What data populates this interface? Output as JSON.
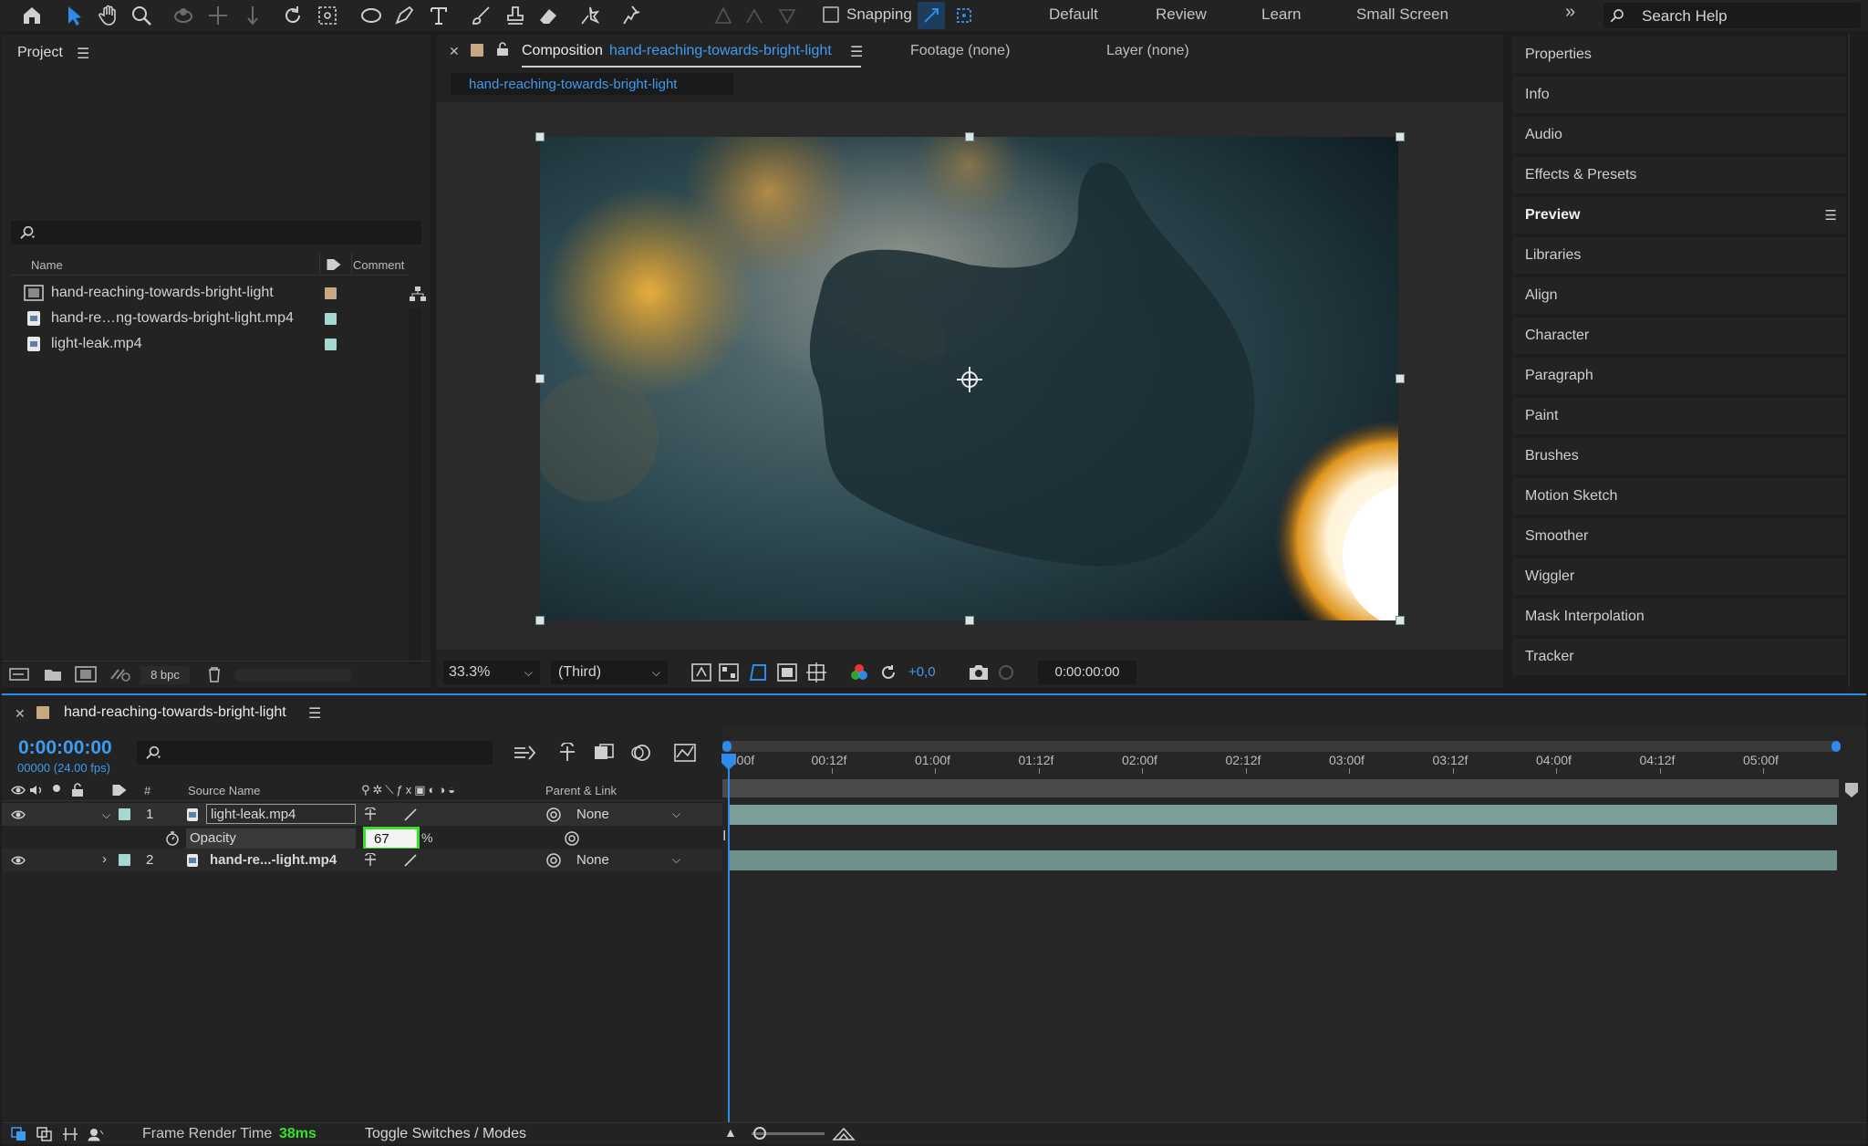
{
  "toolbar": {
    "snapping_label": "Snapping",
    "workspaces": [
      "Default",
      "Review",
      "Learn",
      "Small Screen"
    ],
    "search_placeholder": "Search Help"
  },
  "project": {
    "title": "Project",
    "columns": {
      "name": "Name",
      "comment": "Comment"
    },
    "items": [
      {
        "name": "hand-reaching-towards-bright-light",
        "kind": "composition",
        "color": "#c8a882"
      },
      {
        "name": "hand-re…ng-towards-bright-light.mp4",
        "kind": "footage",
        "color": "#a6d8d2"
      },
      {
        "name": "light-leak.mp4",
        "kind": "footage",
        "color": "#a6d8d2"
      }
    ],
    "bpc": "8 bpc"
  },
  "composition": {
    "tab_prefix": "Composition",
    "tab_name": "hand-reaching-towards-bright-light",
    "footage_tab": "Footage (none)",
    "layer_tab": "Layer (none)",
    "breadcrumb": "hand-reaching-towards-bright-light",
    "zoom": "33.3%",
    "resolution": "(Third)",
    "exposure": "+0,0",
    "timecode": "0:00:00:00"
  },
  "right_panel": {
    "items": [
      "Properties",
      "Info",
      "Audio",
      "Effects & Presets",
      "Preview",
      "Libraries",
      "Align",
      "Character",
      "Paragraph",
      "Paint",
      "Brushes",
      "Motion Sketch",
      "Smoother",
      "Wiggler",
      "Mask Interpolation",
      "Tracker"
    ],
    "active": "Preview"
  },
  "timeline": {
    "tab_name": "hand-reaching-towards-bright-light",
    "current_time": "0:00:00:00",
    "frame_info": "00000 (24.00 fps)",
    "columns": {
      "num": "#",
      "source_name": "Source Name",
      "parent": "Parent & Link"
    },
    "ruler": [
      "0:00f",
      "00:12f",
      "01:00f",
      "01:12f",
      "02:00f",
      "02:12f",
      "03:00f",
      "03:12f",
      "04:00f",
      "04:12f",
      "05:00f"
    ],
    "layers": [
      {
        "num": "1",
        "name": "light-leak.mp4",
        "parent": "None"
      },
      {
        "num": "2",
        "name": "hand-re...-light.mp4",
        "parent": "None"
      }
    ],
    "opacity": {
      "label": "Opacity",
      "value": "67",
      "unit": "%"
    },
    "footer": {
      "render_label": "Frame Render Time",
      "render_value": "38ms",
      "toggle_label": "Toggle Switches / Modes"
    }
  }
}
